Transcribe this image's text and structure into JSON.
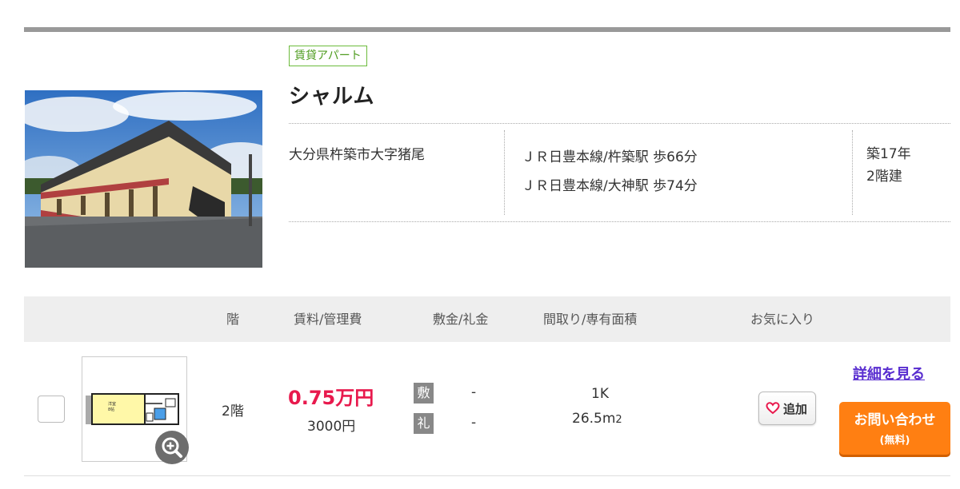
{
  "property": {
    "type_badge": "賃貸アパート",
    "name": "シャルム",
    "address": "大分県杵築市大字猪尾",
    "access": [
      "ＪＲ日豊本線/杵築駅 歩66分",
      "ＪＲ日豊本線/大神駅 歩74分"
    ],
    "age": "築17年",
    "floors": "2階建"
  },
  "table": {
    "headers": {
      "floor": "階",
      "rent": "賃料/管理費",
      "deposit": "敷金/礼金",
      "layout": "間取り/専有面積",
      "favorite": "お気に入り"
    }
  },
  "room": {
    "floor": "2階",
    "rent": "0.75万円",
    "management_fee": "3000円",
    "deposit_label": "敷",
    "deposit_value": "-",
    "key_money_label": "礼",
    "key_money_value": "-",
    "layout": "1K",
    "area_value": "26.5m",
    "area_unit_sup": "2",
    "floorplan_room_label": "洋室",
    "floorplan_size_label": "8帖",
    "favorite_label": "追加",
    "detail_link": "詳細を見る",
    "inquiry_line1": "お問い合わせ",
    "inquiry_line2": "(無料)"
  },
  "colors": {
    "rent": "#e8194d",
    "inquiry_button": "#ff7f12",
    "badge_border": "#6cbb3c",
    "detail_link": "#5a2fd0",
    "header_bg": "#eeeeee"
  },
  "icons": {
    "zoom": "zoom-in-icon",
    "favorite": "heart-icon"
  }
}
